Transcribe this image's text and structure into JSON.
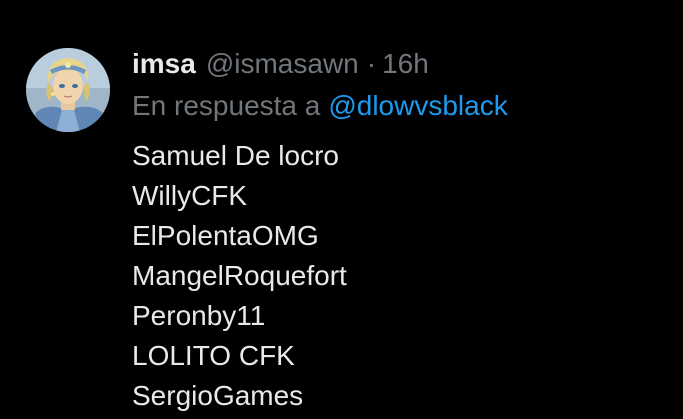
{
  "tweet": {
    "author": {
      "display_name": "imsa",
      "handle": "@ismasawn",
      "separator": "·",
      "timestamp": "16h",
      "avatar_icon": "anime-character-avatar"
    },
    "reply": {
      "prefix": "En respuesta a",
      "mention": "@dlowvsblack"
    },
    "body_lines": [
      "Samuel De locro",
      "WillyCFK",
      "ElPolentaOMG",
      "MangelRoquefort",
      "Peronby11",
      "LOLITO CFK",
      "SergioGames"
    ]
  },
  "colors": {
    "background": "#000000",
    "primary_text": "#e7e9ea",
    "secondary_text": "#71767b",
    "link": "#1d9bf0"
  }
}
